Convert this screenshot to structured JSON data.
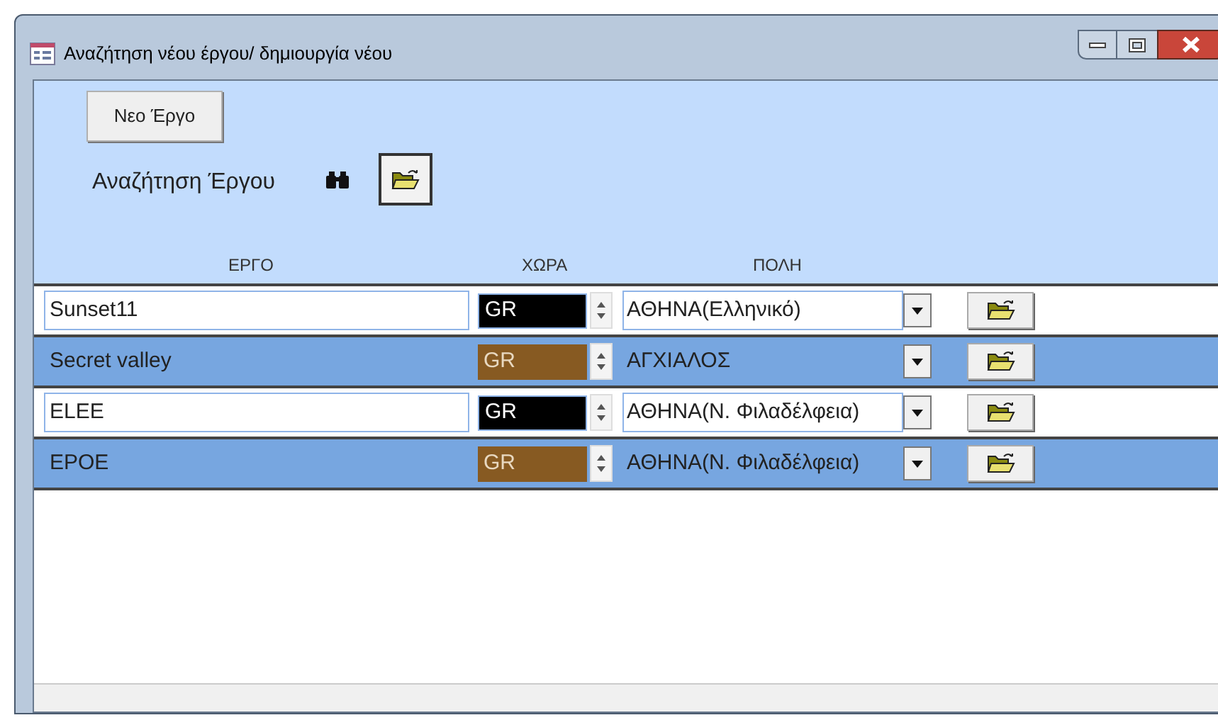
{
  "window": {
    "title": "Αναζήτηση νέου έργου/ δημιουργία νέου"
  },
  "header": {
    "new_button": "Νεο Έργο",
    "search_label": "Αναζήτηση Έργου"
  },
  "columns": [
    "ΕΡΓΟ",
    "ΧΩΡΑ",
    "ΠΟΛΗ"
  ],
  "rows": [
    {
      "name": "Sunset11",
      "country": "GR",
      "city": "ΑΘΗΝΑ(Ελληνικό)",
      "shaded": false
    },
    {
      "name": "Secret valley",
      "country": "GR",
      "city": "ΑΓΧΙΑΛΟΣ",
      "shaded": true
    },
    {
      "name": "ELEE",
      "country": "GR",
      "city": "ΑΘΗΝΑ(Ν. Φιλαδέλφεια)",
      "shaded": false
    },
    {
      "name": "EPOE",
      "country": "GR",
      "city": "ΑΘΗΝΑ(Ν. Φιλαδέλφεια)",
      "shaded": true
    }
  ]
}
